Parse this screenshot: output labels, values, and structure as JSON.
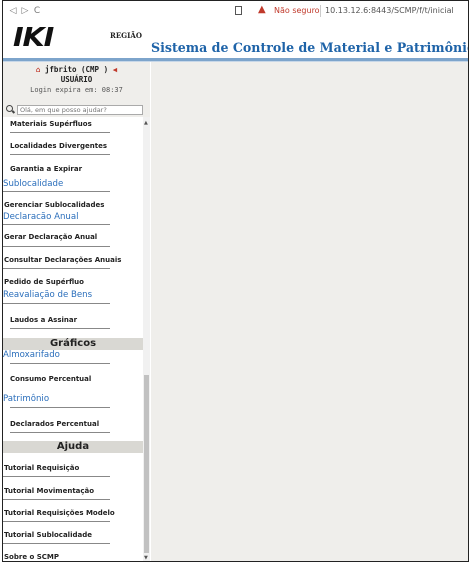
{
  "browser": {
    "nav_back": "◁",
    "nav_forward": "▷",
    "nav_reload": "C",
    "warning_icon": "▲",
    "not_secure": "Não seguro",
    "url": "10.13.12.6:8443/SCMP/f/t/inicial"
  },
  "header": {
    "logo_text": "IKI",
    "logo_sub": "REGIÃO",
    "title": "Sistema de Controle de Material e Patrimônio"
  },
  "user": {
    "name_line": "jfbrito (CMP )",
    "role": "USUÁRIO",
    "login_expire": "Login expira em: 08:37"
  },
  "search": {
    "placeholder": "Olá, em que posso ajudar?"
  },
  "menu": {
    "materiais_superfluos": "Materiais Supérfluos",
    "localidades_divergentes": "Localidades Divergentes",
    "garantia_expirar": "Garantia a Expirar",
    "sublocalidade": "Sublocalidade",
    "gerenciar_sublocalidades": "Gerenciar Sublocalidades",
    "declaracao_anual": "Declaracão Anual",
    "gerar_declaracao": "Gerar Declaração Anual",
    "consultar_declaracoes": "Consultar Declarações Anuais",
    "pedido_superfluo": "Pedido de Supérfluo",
    "reavaliacao_bens": "Reavaliação de Bens",
    "laudos_assinar": "Laudos a Assinar",
    "graficos": "Gráficos",
    "almoxarifado": "Almoxarifado",
    "consumo_percentual": "Consumo Percentual",
    "patrimonio": "Patrimônio",
    "declarados_percentual": "Declarados Percentual",
    "ajuda": "Ajuda",
    "tutorial_requisicao": "Tutorial Requisição",
    "tutorial_movimentacao": "Tutorial Movimentação",
    "tutorial_requisicoes_modelo": "Tutorial Requisições Modelo",
    "tutorial_sublocalidade": "Tutorial Sublocalidade",
    "sobre_scmp": "Sobre o SCMP"
  },
  "colors": {
    "title_blue": "#1e63a8",
    "link_blue": "#2a6ebb",
    "header_stripe": "#7da4cb",
    "panel_bg": "#efeeeb",
    "warning_red": "#c0392b"
  }
}
